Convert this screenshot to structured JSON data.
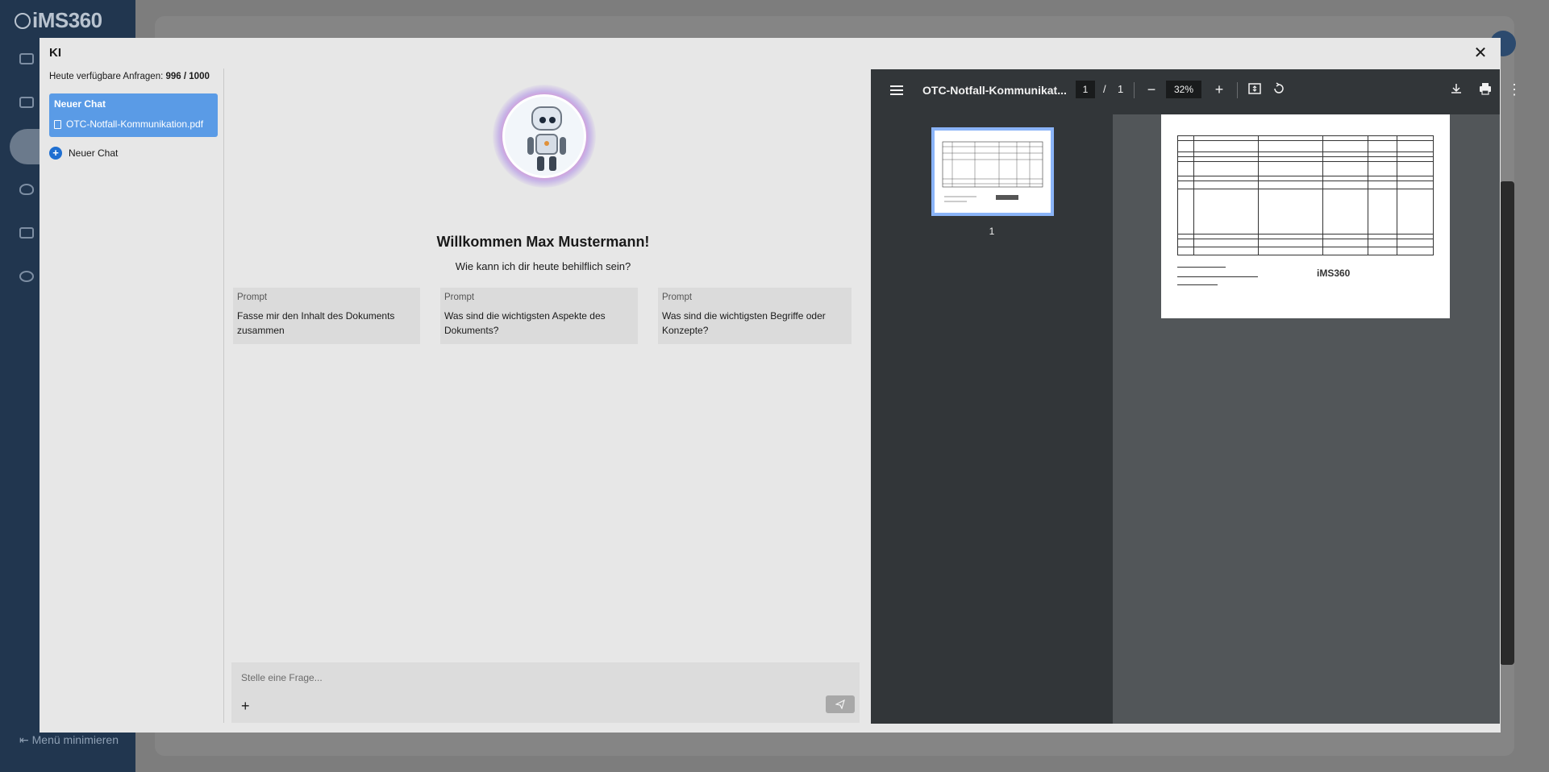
{
  "app": {
    "logo": "iMS360",
    "minimize_label": "Menü minimieren"
  },
  "modal": {
    "title": "KI",
    "close_icon": "close-icon"
  },
  "sidebar": {
    "quota_label": "Heute verfügbare Anfragen:",
    "quota_value": "996 / 1000",
    "active_chat": {
      "title": "Neuer Chat",
      "file": "OTC-Notfall-Kommunikation.pdf"
    },
    "new_chat_label": "Neuer Chat"
  },
  "chat": {
    "welcome": "Willkommen Max Mustermann!",
    "subtitle": "Wie kann ich dir heute behilflich sein?",
    "prompts": [
      {
        "head": "Prompt",
        "text": "Fasse mir den Inhalt des Dokuments zusammen"
      },
      {
        "head": "Prompt",
        "text": "Was sind die wichtigsten Aspekte des Dokuments?"
      },
      {
        "head": "Prompt",
        "text": "Was sind die wichtigsten Begriffe oder Konzepte?"
      }
    ],
    "input_placeholder": "Stelle eine Frage...",
    "add_label": "+"
  },
  "pdf_viewer": {
    "title": "OTC-Notfall-Kommunikat...",
    "current_page": "1",
    "separator": "/",
    "total_pages": "1",
    "zoom": "32%",
    "thumbnail_label": "1",
    "page_logo": "iMS360",
    "toolbar_icons": [
      "menu-icon",
      "zoom-out-icon",
      "zoom-in-icon",
      "fit-page-icon",
      "rotate-icon",
      "download-icon",
      "print-icon",
      "more-icon"
    ]
  },
  "colors": {
    "sidebar_bg": "#21364f",
    "accent_blue": "#5a9be6",
    "plus_blue": "#1f6fd1",
    "pdf_toolbar": "#323639",
    "thumb_border": "#8ab4f8"
  }
}
